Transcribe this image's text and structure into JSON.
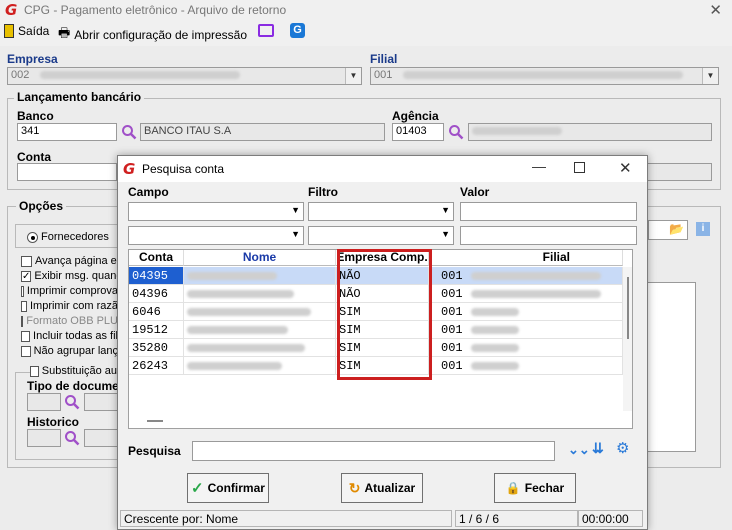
{
  "window": {
    "title": "CPG - Pagamento eletrônico - Arquivo de retorno"
  },
  "toolbar": {
    "exit": "Saída",
    "print_config": "Abrir configuração de impressão"
  },
  "empresa": {
    "label": "Empresa",
    "code": "002"
  },
  "filial": {
    "label": "Filial",
    "code": "001"
  },
  "lancamento": {
    "title": "Lançamento bancário",
    "banco_label": "Banco",
    "banco_code": "341",
    "banco_name": "BANCO ITAU S.A",
    "agencia_label": "Agência",
    "agencia_code": "01403",
    "conta_label": "Conta"
  },
  "opcoes": {
    "title": "Opções",
    "radio_fornecedores": "Fornecedores",
    "checks": [
      {
        "label": "Avança página e",
        "checked": false
      },
      {
        "label": "Exibir msg. quanc",
        "checked": true
      },
      {
        "label": "Imprimir comprova",
        "checked": false
      },
      {
        "label": "Imprimir com razã",
        "checked": false
      },
      {
        "label": "Formato OBB PLU",
        "checked": false
      },
      {
        "label": "Incluir todas as fil",
        "checked": false
      },
      {
        "label": "Não agrupar lanç",
        "checked": false
      }
    ],
    "substituicao": "Substituição au",
    "tipo_doc_label": "Tipo de docume",
    "historico_label": "Historico"
  },
  "dialog": {
    "title": "Pesquisa conta",
    "campo_label": "Campo",
    "filtro_label": "Filtro",
    "valor_label": "Valor",
    "columns": [
      "Conta",
      "Nome",
      "Empresa Comp.",
      "Filial"
    ],
    "rows": [
      {
        "conta": "04395",
        "empresa_comp": "NÃO",
        "filial": "001",
        "selected": true
      },
      {
        "conta": "04396",
        "empresa_comp": "NÃO",
        "filial": "001",
        "selected": false
      },
      {
        "conta": "6046",
        "empresa_comp": "SIM",
        "filial": "001",
        "selected": false
      },
      {
        "conta": "19512",
        "empresa_comp": "SIM",
        "filial": "001",
        "selected": false
      },
      {
        "conta": "35280",
        "empresa_comp": "SIM",
        "filial": "001",
        "selected": false
      },
      {
        "conta": "26243",
        "empresa_comp": "SIM",
        "filial": "001",
        "selected": false
      }
    ],
    "pesquisa_label": "Pesquisa",
    "buttons": {
      "confirm": "Confirmar",
      "refresh": "Atualizar",
      "close": "Fechar"
    },
    "status": {
      "order": "Crescente por: Nome",
      "count": "1 / 6 / 6",
      "time": "00:00:00"
    }
  },
  "colors": {
    "highlight": "#cc1f1f",
    "selection": "#c8daf7",
    "accent_blue": "#1a3a8a"
  }
}
